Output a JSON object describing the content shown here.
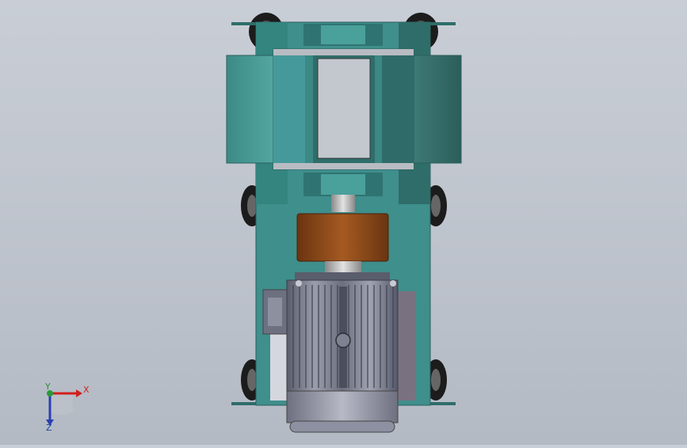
{
  "viewport": {
    "colors": {
      "background_top": "#c9ced6",
      "frame_teal": "#3f8f8c",
      "frame_dark": "#2f6d6a",
      "hopper_teal": "#4aa09b",
      "coupling_brown": "#8b4a1a",
      "motor_grey": "#7d8090",
      "motor_dark": "#5d6070",
      "wheel_black": "#1a1a1a"
    }
  },
  "triad": {
    "x_label": "X",
    "y_label": "Y",
    "z_label": "Z",
    "x_color": "#d0201c",
    "y_color": "#2a9a3a",
    "z_color": "#2a3fb0"
  }
}
